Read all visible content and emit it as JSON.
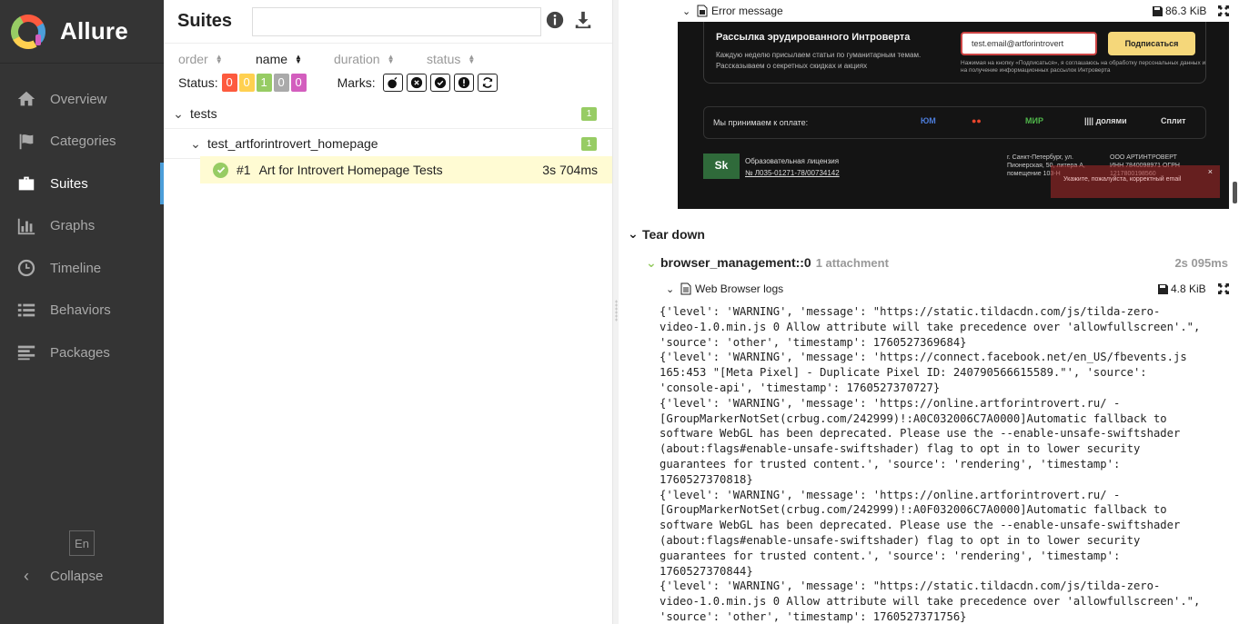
{
  "app": {
    "name": "Allure"
  },
  "sidebar": {
    "items": [
      {
        "label": "Overview",
        "icon": "home-icon",
        "active": false
      },
      {
        "label": "Categories",
        "icon": "flag-icon",
        "active": false
      },
      {
        "label": "Suites",
        "icon": "briefcase-icon",
        "active": true
      },
      {
        "label": "Graphs",
        "icon": "bar-chart-icon",
        "active": false
      },
      {
        "label": "Timeline",
        "icon": "clock-icon",
        "active": false
      },
      {
        "label": "Behaviors",
        "icon": "list-icon",
        "active": false
      },
      {
        "label": "Packages",
        "icon": "align-left-icon",
        "active": false
      }
    ],
    "language": "En",
    "collapse_label": "Collapse"
  },
  "tree": {
    "title": "Suites",
    "search_value": "",
    "sorters": [
      {
        "label": "order",
        "active": false
      },
      {
        "label": "name",
        "active": true
      },
      {
        "label": "duration",
        "active": false
      },
      {
        "label": "status",
        "active": false
      }
    ],
    "status_label": "Status:",
    "status_counts": [
      {
        "value": "0",
        "color": "#fd5a3e",
        "status": "failed"
      },
      {
        "value": "0",
        "color": "#ffd050",
        "status": "broken"
      },
      {
        "value": "1",
        "color": "#97cc64",
        "status": "passed"
      },
      {
        "value": "0",
        "color": "#aaaaaa",
        "status": "skipped"
      },
      {
        "value": "0",
        "color": "#d35ebe",
        "status": "unknown"
      }
    ],
    "marks_label": "Marks:",
    "marks": [
      "flaky-icon",
      "new-failed-icon",
      "new-passed-icon",
      "new-broken-icon",
      "retries-icon"
    ],
    "groups": [
      {
        "name": "tests",
        "count": "1"
      },
      {
        "name": "test_artforintrovert_homepage",
        "count": "1"
      }
    ],
    "test": {
      "number": "#1",
      "name": "Art for Introvert Homepage Tests",
      "duration": "3s 704ms"
    }
  },
  "detail": {
    "error_attachment": {
      "label": "Error message",
      "size": "86.3 KiB"
    },
    "screenshot": {
      "title": "Рассылка эрудированного Интроверта",
      "subtitle": "Каждую неделю присылаем статьи по гуманитарным темам. Рассказываем о секретных скидках и акциях",
      "email_value": "test.email@artforintrovert",
      "subscribe_label": "Подписаться",
      "legal": "Нажимая на кнопку «Подписаться», я соглашаюсь на обработку персональных данных и на получение информационных рассылок Интроверта",
      "pay_label": "Мы принимаем к оплате:",
      "pay_methods": [
        "ЮM",
        "●●",
        "МИР",
        "|||| долями",
        "Сплит"
      ],
      "license_logo": "Sk",
      "license_title": "Образовательная лицензия",
      "license_number": "№ Л035-01271-78/00734142",
      "address": "г. Санкт-Петербург, ул. Пионерская, 50, литера А, помещение 103-Н",
      "org": "ООО АРТИНТРОВЕРТ ИНН 7840098971 ОГРН 1217800198560",
      "toast": "Укажите, пожалуйста, корректный email",
      "toast_close": "×"
    },
    "teardown_title": "Tear down",
    "step": {
      "name": "browser_management::0",
      "attachments": "1 attachment",
      "duration": "2s 095ms"
    },
    "log_attachment": {
      "label": "Web Browser logs",
      "size": "4.8 KiB"
    },
    "log_text": "{'level': 'WARNING', 'message': \"https://static.tildacdn.com/js/tilda-zero-\nvideo-1.0.min.js 0 Allow attribute will take precedence over 'allowfullscreen'.\",\n'source': 'other', 'timestamp': 1760527369684}\n{'level': 'WARNING', 'message': 'https://connect.facebook.net/en_US/fbevents.js\n165:453 \"[Meta Pixel] - Duplicate Pixel ID: 240790566615589.\"', 'source':\n'console-api', 'timestamp': 1760527370727}\n{'level': 'WARNING', 'message': 'https://online.artforintrovert.ru/ -\n[GroupMarkerNotSet(crbug.com/242999)!:A0C032006C7A0000]Automatic fallback to\nsoftware WebGL has been deprecated. Please use the --enable-unsafe-swiftshader\n(about:flags#enable-unsafe-swiftshader) flag to opt in to lower security\nguarantees for trusted content.', 'source': 'rendering', 'timestamp':\n1760527370818}\n{'level': 'WARNING', 'message': 'https://online.artforintrovert.ru/ -\n[GroupMarkerNotSet(crbug.com/242999)!:A0F032006C7A0000]Automatic fallback to\nsoftware WebGL has been deprecated. Please use the --enable-unsafe-swiftshader\n(about:flags#enable-unsafe-swiftshader) flag to opt in to lower security\nguarantees for trusted content.', 'source': 'rendering', 'timestamp':\n1760527370844}\n{'level': 'WARNING', 'message': \"https://static.tildacdn.com/js/tilda-zero-\nvideo-1.0.min.js 0 Allow attribute will take precedence over 'allowfullscreen'.\",\n'source': 'other', 'timestamp': 1760527371756}"
  }
}
